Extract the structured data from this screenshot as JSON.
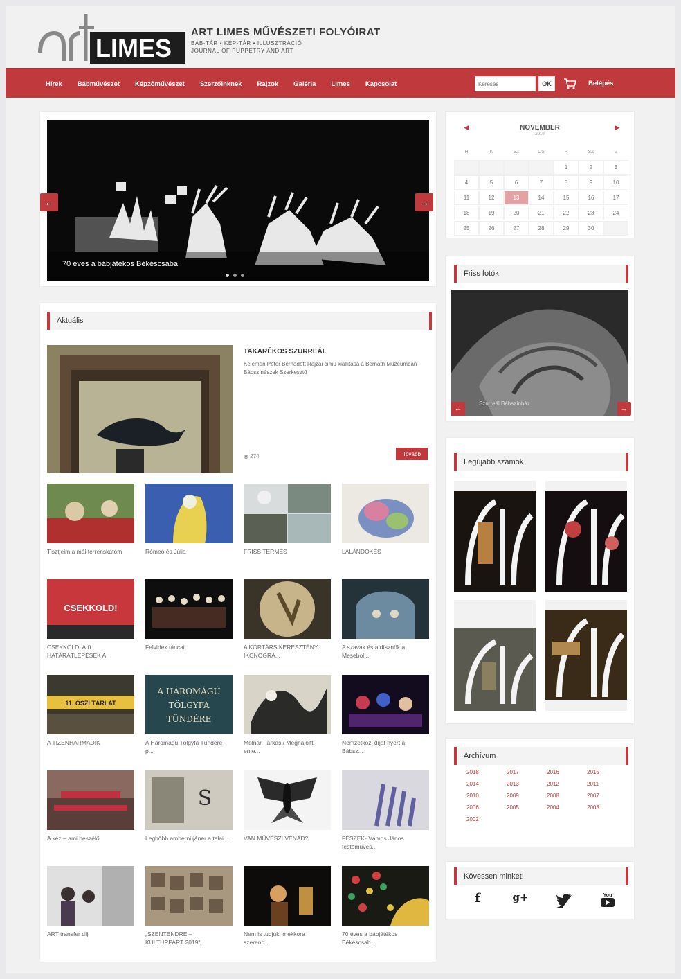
{
  "brand": {
    "title": "ART LIMES MŰVÉSZETI FOLYÓIRAT",
    "subtitle": "BÁB-TÁR • KÉP-TÁR • ILLUSZTRÁCIÓ",
    "subtitle2": "JOURNAL OF PUPPETRY AND ART",
    "logo_text": "LIMES"
  },
  "nav": {
    "items": [
      "Hírek",
      "Bábművészet",
      "Képzőművészet",
      "Szerzőinknek",
      "Rajzok",
      "Galéria",
      "Limes",
      "Kapcsolat"
    ],
    "search_placeholder": "Keresés",
    "search_button": "OK",
    "login": "Belépés"
  },
  "slider": {
    "caption": "70 éves a bábjátékos Békéscsaba",
    "prev": "←",
    "next": "→"
  },
  "news": {
    "section_title": "Aktuális",
    "feature": {
      "title": "TAKARÉKOS SZURREÁL",
      "text": "Kelemen Péter Bernadett Rajzai című kiállítása a Bernáth Múzeumban - Bábszínészek Szerkesztő",
      "views": "274",
      "more": "Tovább"
    },
    "thumbs": [
      {
        "caption": "Tisztjeim a mái terrenskatom"
      },
      {
        "caption": "Rómeó és Júlia"
      },
      {
        "caption": "FRISS TERMÉS"
      },
      {
        "caption": "LALÁNDOKÉS"
      },
      {
        "caption": "CSEKKOLD! A.0 HATÁRÁTLÉPÉSEK A"
      },
      {
        "caption": "Felvidék táncai"
      },
      {
        "caption": "A KORTÁRS KERESZTÉNY IKONOGRÁ..."
      },
      {
        "caption": "A szavak és a dísznök a Mesebol..."
      },
      {
        "caption": "A TIZENHARMADIK"
      },
      {
        "caption": "A Háromágú Tölgyfa Tündére p..."
      },
      {
        "caption": "Molnár Farkas / Meghajoltt eme..."
      },
      {
        "caption": "Nemzetközi díjat nyert a Bábsz..."
      },
      {
        "caption": "A kéz – ami beszélő"
      },
      {
        "caption": "Leghőbb ambernüjáner a talai..."
      },
      {
        "caption": "VAN MŰVÉSZI VÉNÁD?"
      },
      {
        "caption": "FÉSZEK- Vámos János festőművés..."
      },
      {
        "caption": "ART transfer díj"
      },
      {
        "caption": "„SZENTENDRE – KULTÚRPART 2019\"..."
      },
      {
        "caption": "Nem is tudjuk, mekkora szerenc..."
      },
      {
        "caption": "70 éves a bábjátékos Békéscsab..."
      }
    ],
    "slider_banner_text": "CSEKKOLD!",
    "oszi_text": "11. ŐSZI TÁRLAT",
    "tolgy_text": "A HÁROMÁGÚ TÖLGYFA TÜNDÉRE"
  },
  "calendar": {
    "month": "NOVEMBER",
    "year": "2019",
    "prev": "◄",
    "next": "►",
    "weekdays": [
      "H",
      "K",
      "SZ",
      "CS",
      "P",
      "SZ",
      "V"
    ],
    "weeks": [
      [
        "",
        "",
        "",
        "",
        "1",
        "2",
        "3"
      ],
      [
        "4",
        "5",
        "6",
        "7",
        "8",
        "9",
        "10"
      ],
      [
        "11",
        "12",
        "13",
        "14",
        "15",
        "16",
        "17"
      ],
      [
        "18",
        "19",
        "20",
        "21",
        "22",
        "23",
        "24"
      ],
      [
        "25",
        "26",
        "27",
        "28",
        "29",
        "30",
        ""
      ]
    ],
    "today": "13"
  },
  "photos": {
    "section_title": "Friss fotók",
    "caption": "Szurreál Bábszínház"
  },
  "issues": {
    "section_title": "Legújabb számok"
  },
  "archive": {
    "section_title": "Archívum",
    "years": [
      "2018",
      "2017",
      "2016",
      "2015",
      "2014",
      "2013",
      "2012",
      "2011",
      "2010",
      "2009",
      "2008",
      "2007",
      "2006",
      "2005",
      "2004",
      "2003",
      "2002"
    ]
  },
  "follow": {
    "section_title": "Kövessen minket!",
    "icons": [
      "f",
      "g+",
      "twitter",
      "youtube"
    ]
  },
  "colors": {
    "accent": "#c0393c",
    "background": "#e9e9eb"
  }
}
